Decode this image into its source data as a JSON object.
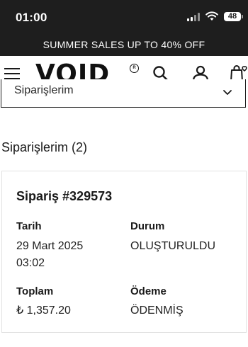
{
  "status_bar": {
    "time": "01:00",
    "battery": "48"
  },
  "promo": {
    "text": "SUMMER SALES UP TO 40% OFF"
  },
  "header": {
    "logo": "VOID",
    "logo_mark": "R"
  },
  "filter": {
    "selected": "Siparişlerim"
  },
  "orders": {
    "title": "Siparişlerim (2)",
    "items": [
      {
        "title": "Sipariş #329573",
        "date_label": "Tarih",
        "date_value": "29 Mart 2025",
        "time_value": "03:02",
        "status_label": "Durum",
        "status_value": "OLUŞTURULDU",
        "total_label": "Toplam",
        "total_value": "₺ 1,357.20",
        "payment_label": "Ödeme",
        "payment_value": "ÖDENMİŞ"
      }
    ]
  },
  "icons": [
    "signal-icon",
    "wifi-icon",
    "battery-icon",
    "menu-icon",
    "search-icon",
    "account-icon",
    "wishlist-bag-icon",
    "chevron-down-icon"
  ]
}
